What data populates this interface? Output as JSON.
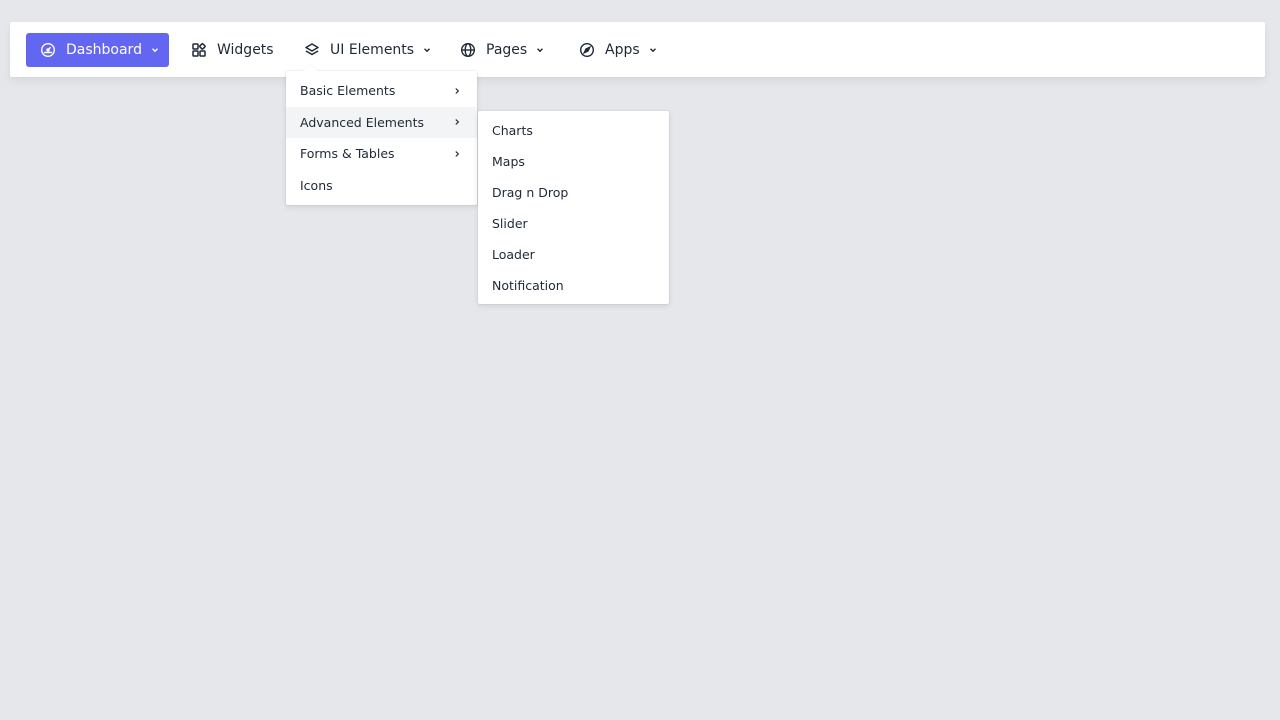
{
  "colors": {
    "accent": "#6366f1",
    "background": "#e5e7eb",
    "surface": "#ffffff",
    "text": "#1f2937",
    "hover": "#f3f4f6"
  },
  "navbar": {
    "items": [
      {
        "label": "Dashboard",
        "icon": "speedometer-icon",
        "has_caret": true,
        "active": true
      },
      {
        "label": "Widgets",
        "icon": "widgets-grid-icon",
        "has_caret": false,
        "active": false
      },
      {
        "label": "UI Elements",
        "icon": "layers-icon",
        "has_caret": true,
        "active": false
      },
      {
        "label": "Pages",
        "icon": "globe-icon",
        "has_caret": true,
        "active": false
      },
      {
        "label": "Apps",
        "icon": "compass-icon",
        "has_caret": true,
        "active": false
      }
    ]
  },
  "dropdown": {
    "items": [
      {
        "label": "Basic Elements",
        "has_submenu": true
      },
      {
        "label": "Advanced Elements",
        "has_submenu": true,
        "hovered": true
      },
      {
        "label": "Forms & Tables",
        "has_submenu": true
      },
      {
        "label": "Icons",
        "has_submenu": false
      }
    ]
  },
  "submenu": {
    "items": [
      {
        "label": "Charts"
      },
      {
        "label": "Maps"
      },
      {
        "label": "Drag n Drop"
      },
      {
        "label": "Slider"
      },
      {
        "label": "Loader"
      },
      {
        "label": "Notification"
      }
    ]
  }
}
